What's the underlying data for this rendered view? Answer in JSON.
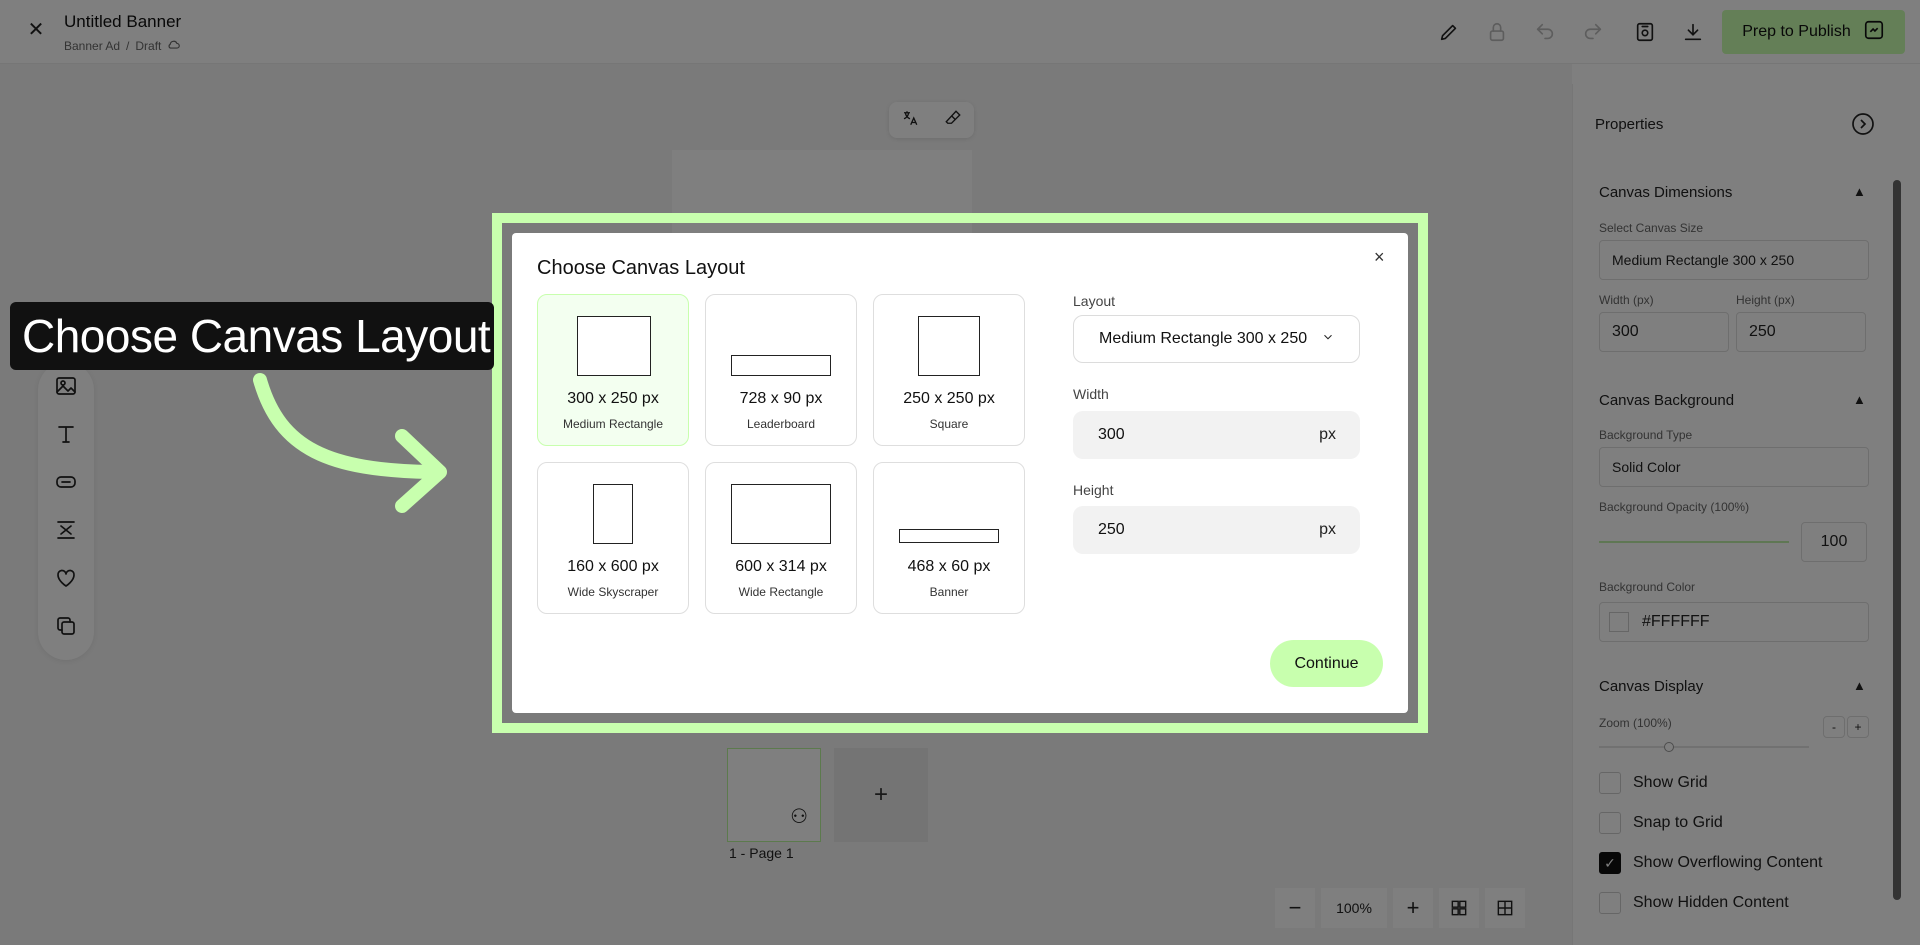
{
  "header": {
    "title": "Untitled Banner",
    "meta_type": "Banner Ad",
    "meta_sep": "/",
    "meta_status": "Draft",
    "publish_label": "Prep to Publish"
  },
  "canvas": {
    "page_label": "1 - Page 1",
    "add_label": "+",
    "zoom": "100%"
  },
  "properties": {
    "title": "Properties",
    "dimensions": {
      "heading": "Canvas Dimensions",
      "size_label": "Select Canvas Size",
      "size_value": "Medium Rectangle 300 x 250",
      "width_label": "Width (px)",
      "width_value": "300",
      "height_label": "Height (px)",
      "height_value": "250"
    },
    "background": {
      "heading": "Canvas Background",
      "type_label": "Background Type",
      "type_value": "Solid Color",
      "opacity_label": "Background Opacity (100%)",
      "opacity_value": "100",
      "color_label": "Background Color",
      "color_value": "#FFFFFF"
    },
    "display": {
      "heading": "Canvas Display",
      "zoom_label": "Zoom (100%)",
      "minus": "-",
      "plus": "+",
      "options": [
        {
          "label": "Show Grid",
          "checked": false
        },
        {
          "label": "Snap to Grid",
          "checked": false
        },
        {
          "label": "Show Overflowing Content",
          "checked": true
        },
        {
          "label": "Show Hidden Content",
          "checked": false
        }
      ]
    }
  },
  "modal": {
    "title": "Choose Canvas Layout",
    "close": "×",
    "layouts": [
      {
        "size": "300 x 250 px",
        "name": "Medium Rectangle",
        "selected": true
      },
      {
        "size": "728 x 90 px",
        "name": "Leaderboard",
        "selected": false
      },
      {
        "size": "250 x 250 px",
        "name": "Square",
        "selected": false
      },
      {
        "size": "160 x 600 px",
        "name": "Wide Skyscraper",
        "selected": false
      },
      {
        "size": "600 x 314 px",
        "name": "Wide Rectangle",
        "selected": false
      },
      {
        "size": "468 x 60 px",
        "name": "Banner",
        "selected": false
      }
    ],
    "layout_label": "Layout",
    "layout_value": "Medium Rectangle 300 x 250",
    "width_label": "Width",
    "width_value": "300",
    "height_label": "Height",
    "height_value": "250",
    "unit": "px",
    "continue_label": "Continue"
  },
  "callout": {
    "text": "Choose Canvas Layout"
  },
  "colors": {
    "accent": "#c8ffae",
    "overlay": "rgba(0,0,0,0.5)"
  }
}
